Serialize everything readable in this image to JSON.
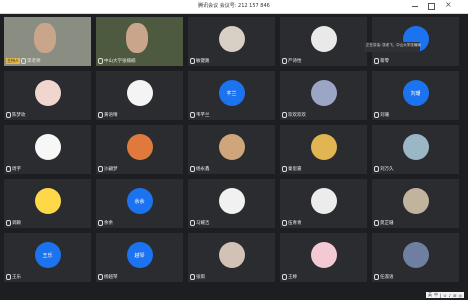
{
  "window": {
    "title": "腾讯会议 会议号: 212 157 846"
  },
  "tooltip": {
    "text": "正在讲话: 张老飞、中山大学张楠楠"
  },
  "tray": {
    "items": [
      "英",
      "中",
      "J",
      "⊙",
      "♪",
      "⊞",
      "◎"
    ]
  },
  "tiles": [
    {
      "name": "李老师",
      "badge": "主持人",
      "type": "video",
      "bg": "#8a8e82"
    },
    {
      "name": "中山大学张楠楠",
      "type": "video",
      "bg": "#4d5a3f"
    },
    {
      "name": "敏键路",
      "type": "avatar",
      "avatar_bg": "#d8cfc5",
      "icon": "sheep-avatar-icon"
    },
    {
      "name": "严诗怡",
      "type": "avatar",
      "avatar_bg": "#e9e9e9",
      "icon": "cartoon-avatar-icon"
    },
    {
      "name": "蒋零",
      "type": "avatar",
      "avatar_bg": "#1c73f0",
      "icon": "blue-avatar-icon",
      "label": ""
    },
    {
      "name": "陈梦玫",
      "type": "avatar",
      "avatar_bg": "#f1d6d0",
      "icon": "girl-avatar-icon"
    },
    {
      "name": "黄语晴",
      "type": "avatar",
      "avatar_bg": "#f4f4f4",
      "icon": "sketch-avatar-icon"
    },
    {
      "name": "韦芊兰",
      "type": "avatar",
      "avatar_bg": "#1c73f0",
      "icon": "text-avatar-icon",
      "label": "芊兰"
    },
    {
      "name": "欢欢欢欢",
      "type": "avatar",
      "avatar_bg": "#9aa6c4",
      "icon": "photo-avatar-icon"
    },
    {
      "name": "刘珊",
      "type": "avatar",
      "avatar_bg": "#1c73f0",
      "icon": "text-avatar-icon",
      "label": "刘珊"
    },
    {
      "name": "周宇",
      "type": "avatar",
      "avatar_bg": "#f7f7f7",
      "icon": "sketch-avatar-icon"
    },
    {
      "name": "沙翩梦",
      "type": "avatar",
      "avatar_bg": "#e07a3c",
      "icon": "photo-avatar-icon"
    },
    {
      "name": "杨永鑫",
      "type": "avatar",
      "avatar_bg": "#cfa67c",
      "icon": "photo-avatar-icon"
    },
    {
      "name": "秦思嘉",
      "type": "avatar",
      "avatar_bg": "#e0b552",
      "icon": "pikachu-avatar-icon"
    },
    {
      "name": "刘万久",
      "type": "avatar",
      "avatar_bg": "#9bb7c6",
      "icon": "photo-avatar-icon"
    },
    {
      "name": "调颖",
      "type": "avatar",
      "avatar_bg": "#ffd84a",
      "icon": "emoji-avatar-icon"
    },
    {
      "name": "余余",
      "type": "avatar",
      "avatar_bg": "#1c73f0",
      "icon": "text-avatar-icon",
      "label": "余余"
    },
    {
      "name": "马耀吉",
      "type": "avatar",
      "avatar_bg": "#f1f1f1",
      "icon": "badge-avatar-icon"
    },
    {
      "name": "伍青青",
      "type": "avatar",
      "avatar_bg": "#ececec",
      "icon": "girl-avatar-icon"
    },
    {
      "name": "莫芷珊",
      "type": "avatar",
      "avatar_bg": "#c2b39e",
      "icon": "photo-avatar-icon"
    },
    {
      "name": "王乐",
      "type": "avatar",
      "avatar_bg": "#1c73f0",
      "icon": "text-avatar-icon",
      "label": "王乐"
    },
    {
      "name": "杨越琴",
      "type": "avatar",
      "avatar_bg": "#1c73f0",
      "icon": "text-avatar-icon",
      "label": "越琴"
    },
    {
      "name": "张雨",
      "type": "avatar",
      "avatar_bg": "#d1c2b5",
      "icon": "dog-avatar-icon"
    },
    {
      "name": "王婷",
      "type": "avatar",
      "avatar_bg": "#f3c9d4",
      "icon": "flower-avatar-icon"
    },
    {
      "name": "任淑语",
      "type": "avatar",
      "avatar_bg": "#6e7fa1",
      "icon": "photo-avatar-icon"
    }
  ]
}
